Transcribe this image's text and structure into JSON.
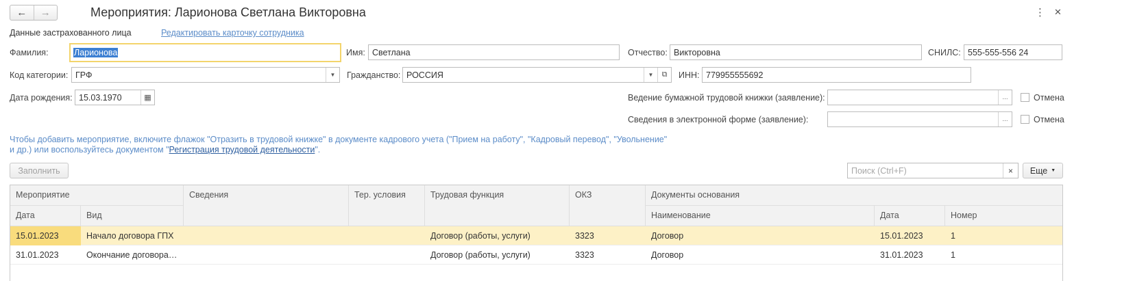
{
  "window": {
    "title": "Мероприятия: Ларионова Светлана Викторовна",
    "back_icon": "←",
    "forward_icon": "→",
    "more_icon": "⋮",
    "close_icon": "✕"
  },
  "header": {
    "section_label": "Данные застрахованного лица",
    "edit_link": "Редактировать карточку сотрудника"
  },
  "form": {
    "surname_label": "Фамилия:",
    "surname_value": "Ларионова",
    "name_label": "Имя:",
    "name_value": "Светлана",
    "patronymic_label": "Отчество:",
    "patronymic_value": "Викторовна",
    "snils_label": "СНИЛС:",
    "snils_value": "555-555-556 24",
    "category_label": "Код категории:",
    "category_value": "ГРФ",
    "citizenship_label": "Гражданство:",
    "citizenship_value": "РОССИЯ",
    "inn_label": "ИНН:",
    "inn_value": "779955555692",
    "birthdate_label": "Дата рождения:",
    "birthdate_value": "15.03.1970",
    "paper_book_label": "Ведение бумажной трудовой книжки (заявление):",
    "paper_book_value": "",
    "electronic_label": "Сведения в электронной форме (заявление):",
    "electronic_value": "",
    "cancel_label": "Отмена",
    "ellipsis": "..."
  },
  "info": {
    "text_part1": "Чтобы добавить мероприятие, включите флажок \"Отразить в трудовой книжке\" в документе кадрового учета (\"Прием на работу\", \"Кадровый перевод\", \"Увольнение\"",
    "text_part2": "и др.) или воспользуйтесь документом \"",
    "link": "Регистрация трудовой деятельности",
    "text_part3": "\"."
  },
  "toolbar": {
    "fill_button": "Заполнить",
    "search_placeholder": "Поиск (Ctrl+F)",
    "search_clear": "×",
    "more_button": "Еще"
  },
  "table": {
    "headers": {
      "event": "Мероприятие",
      "date": "Дата",
      "kind": "Вид",
      "details": "Сведения",
      "territorial": "Тер. условия",
      "labor_function": "Трудовая функция",
      "okz": "ОКЗ",
      "base_docs": "Документы основания",
      "doc_name": "Наименование",
      "doc_date": "Дата",
      "doc_number": "Номер"
    },
    "rows": [
      {
        "date": "15.01.2023",
        "kind": "Начало договора ГПХ",
        "details": "",
        "territorial": "",
        "labor_function": "Договор (работы, услуги)",
        "okz": "3323",
        "doc_name": "Договор",
        "doc_date": "15.01.2023",
        "doc_number": "1"
      },
      {
        "date": "31.01.2023",
        "kind": "Окончание договора ГПХ",
        "details": "",
        "territorial": "",
        "labor_function": "Договор (работы, услуги)",
        "okz": "3323",
        "doc_name": "Договор",
        "doc_date": "31.01.2023",
        "doc_number": "1"
      }
    ]
  }
}
